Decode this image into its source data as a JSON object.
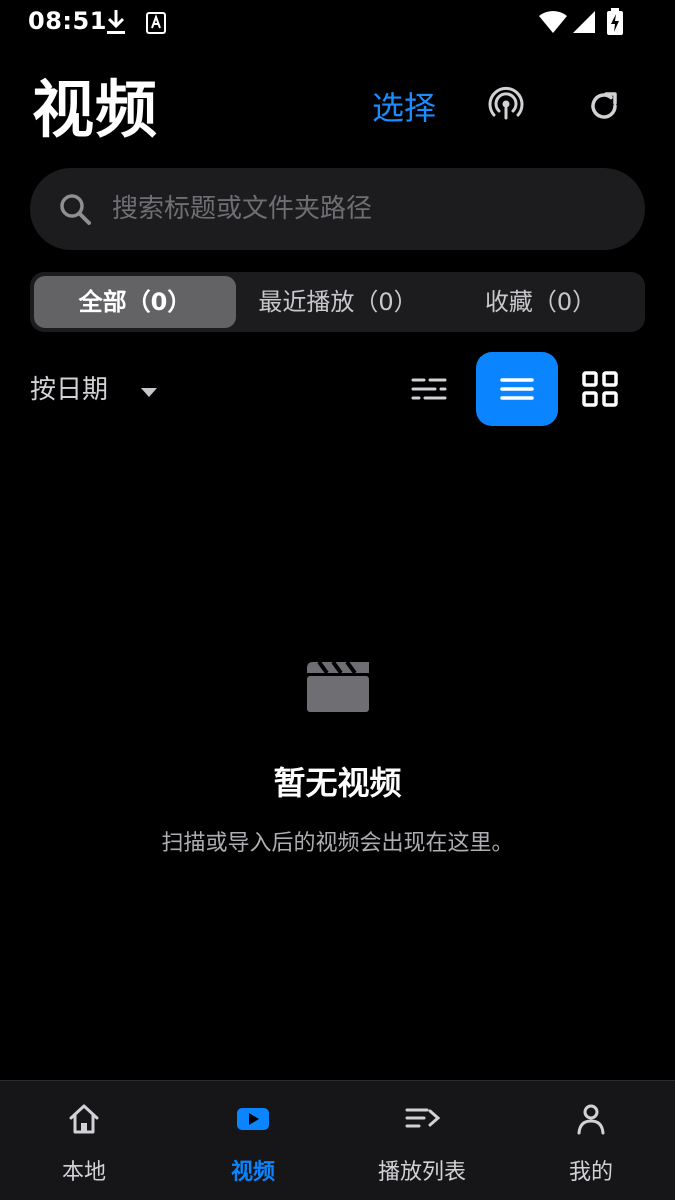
{
  "status_bar": {
    "time": "08:51",
    "icons": [
      "download-icon",
      "a-badge-icon",
      "wifi-icon",
      "signal-icon",
      "battery-charging-icon"
    ]
  },
  "header": {
    "title": "视频",
    "select_label": "选择",
    "icons": [
      "broadcast-icon",
      "refresh-icon"
    ]
  },
  "search": {
    "placeholder": "搜索标题或文件夹路径",
    "value": ""
  },
  "tabs": [
    {
      "label": "全部（0）",
      "active": true
    },
    {
      "label": "最近播放（0）",
      "active": false
    },
    {
      "label": "收藏（0）",
      "active": false
    }
  ],
  "sort": {
    "label": "按日期",
    "icon": "caret-down-icon"
  },
  "view_modes": [
    {
      "icon": "filter-sliders-icon",
      "active": false
    },
    {
      "icon": "list-view-icon",
      "active": true
    },
    {
      "icon": "grid-view-icon",
      "active": false
    }
  ],
  "empty_state": {
    "icon": "clapperboard-icon",
    "title": "暂无视频",
    "description": "扫描或导入后的视频会出现在这里。"
  },
  "bottom_nav": [
    {
      "label": "本地",
      "icon": "home-icon",
      "active": false
    },
    {
      "label": "视频",
      "icon": "play-icon",
      "active": true
    },
    {
      "label": "播放列表",
      "icon": "playlist-icon",
      "active": false
    },
    {
      "label": "我的",
      "icon": "user-icon",
      "active": false
    }
  ],
  "colors": {
    "accent": "#0a84ff",
    "background": "#000000",
    "surface": "#1c1c1e"
  }
}
